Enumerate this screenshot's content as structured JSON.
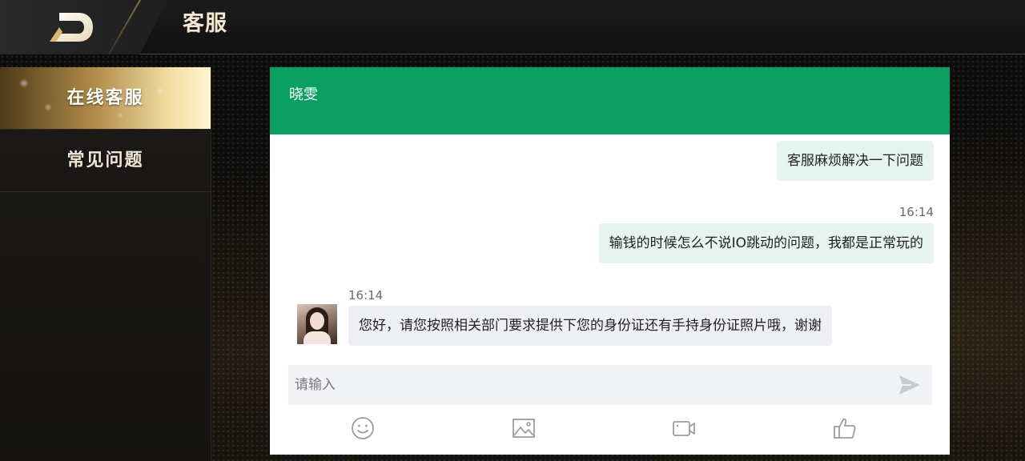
{
  "header": {
    "title": "客服",
    "back_icon": "back-arrow-icon"
  },
  "sidebar": {
    "items": [
      {
        "label": "在线客服",
        "active": true
      },
      {
        "label": "常见问题",
        "active": false
      }
    ]
  },
  "chat": {
    "agent_name": "晓雯",
    "header_color": "#0aa062",
    "messages": [
      {
        "direction": "out",
        "text": "客服麻烦解决一下问题",
        "time": ""
      },
      {
        "direction": "out",
        "text": "输钱的时候怎么不说IO跳动的问题，我都是正常玩的",
        "time": "16:14"
      },
      {
        "direction": "in",
        "text": "您好，请您按照相关部门要求提供下您的身份证还有手持身份证照片哦，谢谢",
        "time": "16:14"
      }
    ],
    "input": {
      "placeholder": "请输入",
      "value": ""
    },
    "toolbar": [
      "emoji-icon",
      "image-icon",
      "video-icon",
      "thumbs-up-icon"
    ]
  }
}
